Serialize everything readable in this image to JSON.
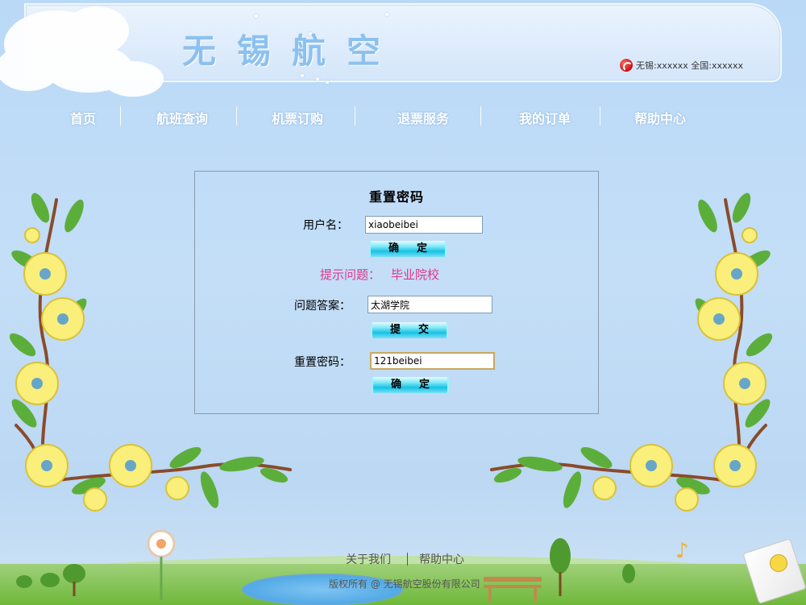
{
  "header": {
    "site_title": "无锡航空",
    "hotline": "无锡:xxxxxx  全国:xxxxxx"
  },
  "nav": {
    "items": [
      {
        "label": "首页"
      },
      {
        "label": "航班查询"
      },
      {
        "label": "机票订购"
      },
      {
        "label": "退票服务"
      },
      {
        "label": "我的订单"
      },
      {
        "label": "帮助中心"
      }
    ]
  },
  "form": {
    "title": "重置密码",
    "username_label": "用户名：",
    "username_value": "xiaobeibei",
    "confirm_label": "确定",
    "hint_label": "提示问题：",
    "hint_value": "毕业院校",
    "answer_label": "问题答案：",
    "answer_value": "太湖学院",
    "submit_label": "提交",
    "new_password_label": "重置密码：",
    "new_password_value": "121beibei",
    "confirm2_label": "确定"
  },
  "footer": {
    "about_label": "关于我们",
    "help_label": "帮助中心",
    "copyright": "版权所有 @ 无锡航空股份有限公司"
  },
  "colors": {
    "hint": "#e0368c",
    "title": "#8cc1ef",
    "button": "#16c2e6"
  }
}
